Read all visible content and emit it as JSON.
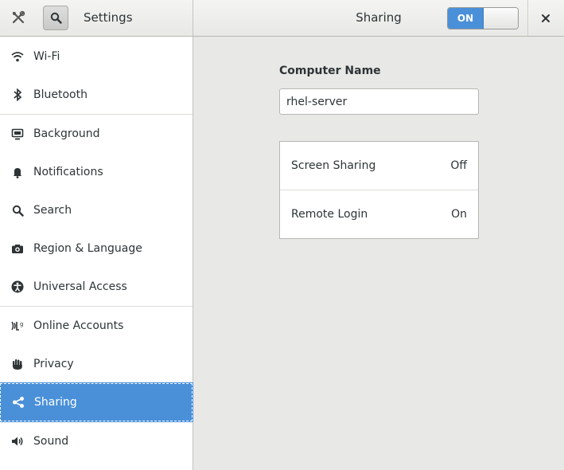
{
  "header": {
    "left_title": "Settings",
    "center_title": "Sharing",
    "switch_label": "ON",
    "close_glyph": "✕"
  },
  "sidebar": {
    "items": [
      {
        "label": "Wi-Fi",
        "icon": "wifi-icon"
      },
      {
        "label": "Bluetooth",
        "icon": "bluetooth-icon"
      },
      {
        "label": "Background",
        "icon": "display-icon"
      },
      {
        "label": "Notifications",
        "icon": "bell-icon"
      },
      {
        "label": "Search",
        "icon": "search-icon"
      },
      {
        "label": "Region & Language",
        "icon": "camera-icon"
      },
      {
        "label": "Universal Access",
        "icon": "accessibility-icon"
      },
      {
        "label": "Online Accounts",
        "icon": "online-accounts-icon"
      },
      {
        "label": "Privacy",
        "icon": "hand-icon"
      },
      {
        "label": "Sharing",
        "icon": "share-icon",
        "selected": true
      },
      {
        "label": "Sound",
        "icon": "speaker-icon"
      }
    ]
  },
  "main": {
    "computer_name_label": "Computer Name",
    "computer_name_value": "rhel-server",
    "services": [
      {
        "label": "Screen Sharing",
        "value": "Off"
      },
      {
        "label": "Remote Login",
        "value": "On"
      }
    ]
  },
  "colors": {
    "accent": "#4a90d9",
    "sidebar_bg": "#ffffff",
    "main_bg": "#e8e8e7"
  }
}
